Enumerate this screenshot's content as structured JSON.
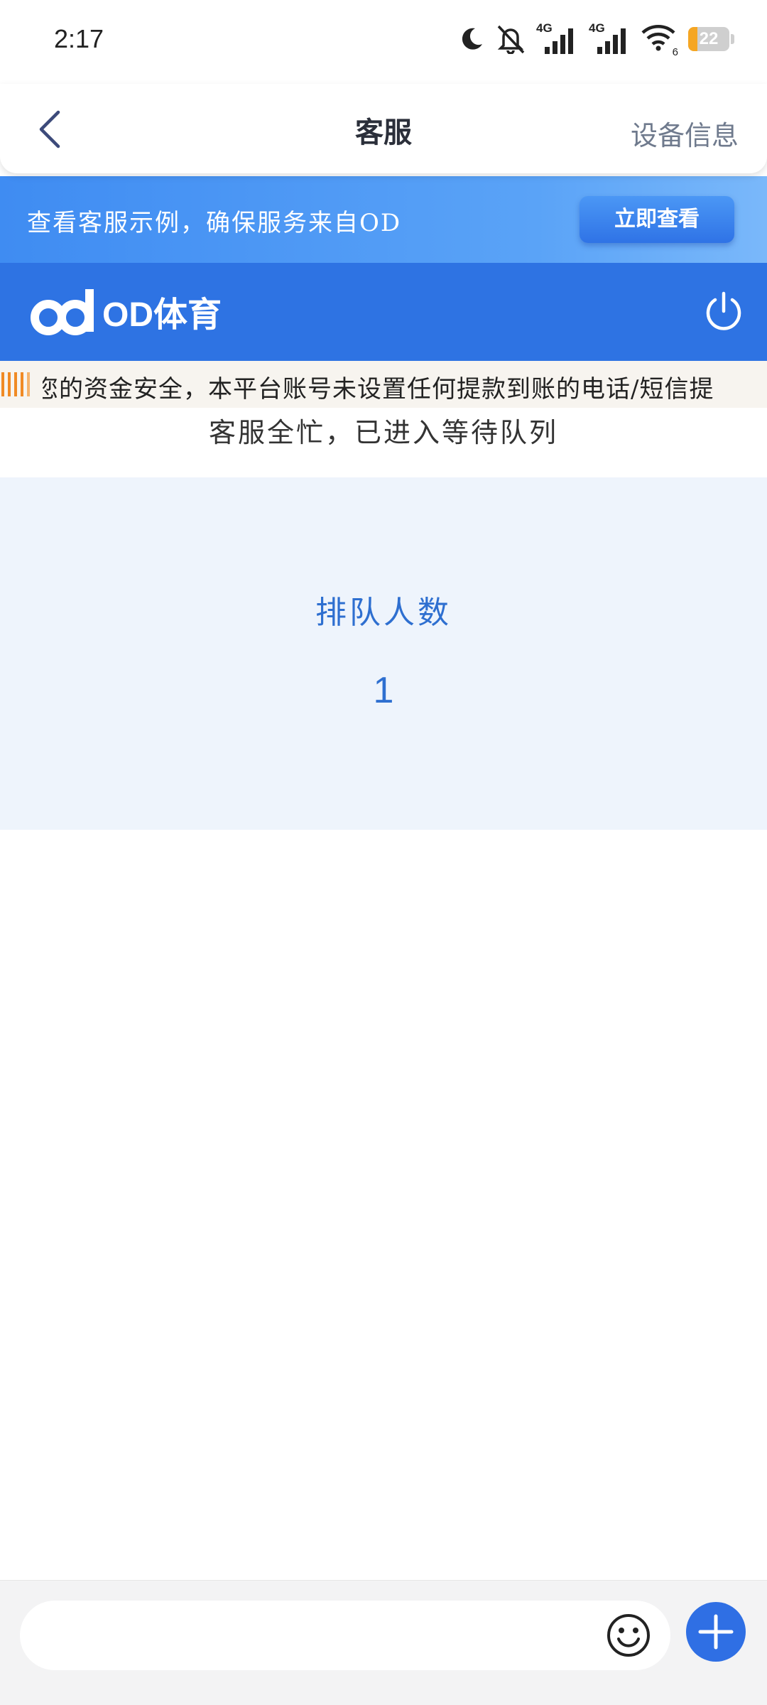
{
  "status_bar": {
    "time": "2:17",
    "network_1": "4G",
    "network_2": "4G",
    "wifi_sub": "6",
    "battery_level": "22",
    "battery_fraction": 0.22
  },
  "header": {
    "title": "客服",
    "device_info_label": "设备信息"
  },
  "banner": {
    "text": "查看客服示例，确保服务来自OD",
    "button_label": "立即查看"
  },
  "brand": {
    "logo_text": "OD体育"
  },
  "marquee": {
    "text": "您的资金安全，本平台账号未设置任何提款到账的电话/短信提"
  },
  "queue": {
    "status_message": "客服全忙，已进入等待队列",
    "label": "排队人数",
    "count": "1"
  },
  "input_bar": {
    "placeholder": ""
  },
  "colors": {
    "brand_blue": "#2e73e3",
    "accent_text": "#2e6fd0",
    "battery_orange": "#f5a623",
    "panel_bg": "#eef4fc"
  }
}
